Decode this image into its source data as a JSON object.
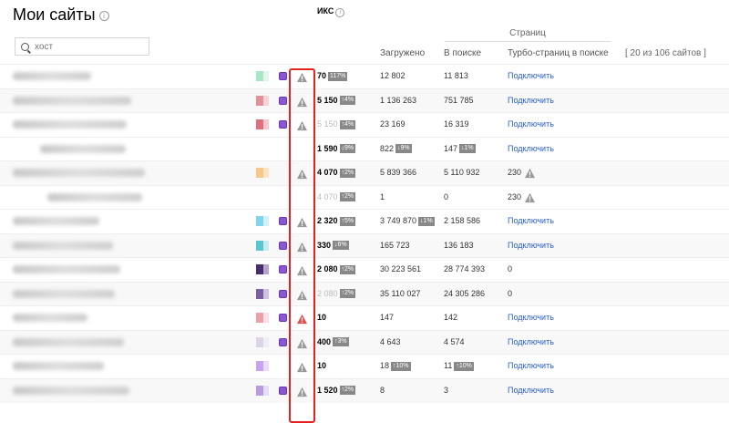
{
  "page": {
    "title": "Мои сайты",
    "info_glyph": "i"
  },
  "search": {
    "placeholder": "хост"
  },
  "header": {
    "group_label": "Страниц",
    "iks": "ИКС",
    "loaded": "Загружено",
    "in_search": "В поиске",
    "turbo": "Турбо-страниц в поиске",
    "count": "[ 20 из 106 сайтов ]"
  },
  "colors": {
    "link": "#2a60c7",
    "highlight": "#e52222",
    "warn_gray": "#999999",
    "warn_red": "#e05050",
    "favicon": "#8b57d1"
  },
  "rows": [
    {
      "host_w": 86,
      "indent": 0,
      "swatches": [
        "#a6e7c6",
        "#e6f4ea"
      ],
      "favicon": true,
      "warn": "gray",
      "iks": "70",
      "iks_badge": "117%",
      "iks_dim": false,
      "loaded": "12 802",
      "loaded_badge": "",
      "in_search": "11 813",
      "search_badge": "",
      "turbo_type": "link",
      "turbo": "Подключить",
      "alt": false
    },
    {
      "host_w": 130,
      "indent": 0,
      "swatches": [
        "#e3909b",
        "#f5d3d7"
      ],
      "favicon": true,
      "warn": "gray",
      "iks": "5 150",
      "iks_badge": "↑4%",
      "iks_dim": false,
      "loaded": "1 136 263",
      "loaded_badge": "",
      "in_search": "751 785",
      "search_badge": "",
      "turbo_type": "link",
      "turbo": "Подключить",
      "alt": true
    },
    {
      "host_w": 125,
      "indent": 0,
      "swatches": [
        "#e1707c",
        "#f4c9ce"
      ],
      "favicon": true,
      "warn": "gray",
      "iks": "5 150",
      "iks_badge": "↑4%",
      "iks_dim": true,
      "loaded": "23 169",
      "loaded_badge": "",
      "in_search": "16 319",
      "search_badge": "",
      "turbo_type": "link",
      "turbo": "Подключить",
      "alt": false
    },
    {
      "host_w": 94,
      "indent": 30,
      "swatches": [],
      "favicon": false,
      "warn": "none",
      "iks": "1 590",
      "iks_badge": "↓9%",
      "iks_dim": false,
      "loaded": "822",
      "loaded_badge": "↓9%",
      "in_search": "147",
      "search_badge": "↓1%",
      "turbo_type": "link",
      "turbo": "Подключить",
      "alt": false
    },
    {
      "host_w": 145,
      "indent": 0,
      "swatches": [
        "#f6c88c",
        "#fbe3c4"
      ],
      "favicon": false,
      "warn": "gray",
      "iks": "4 070",
      "iks_badge": "↑2%",
      "iks_dim": false,
      "loaded": "5 839 366",
      "loaded_badge": "",
      "in_search": "5 110 932",
      "search_badge": "",
      "turbo_type": "num",
      "turbo": "230",
      "alt": true
    },
    {
      "host_w": 104,
      "indent": 38,
      "swatches": [],
      "favicon": false,
      "warn": "none",
      "iks": "4 070",
      "iks_badge": "↑2%",
      "iks_dim": true,
      "loaded": "1",
      "loaded_badge": "",
      "in_search": "0",
      "search_badge": "",
      "turbo_type": "num",
      "turbo": "230",
      "alt": false
    },
    {
      "host_w": 95,
      "indent": 0,
      "swatches": [
        "#7fd6ee",
        "#d4f1f9"
      ],
      "favicon": true,
      "warn": "gray",
      "iks": "2 320",
      "iks_badge": "↑5%",
      "iks_dim": false,
      "loaded": "3 749 870",
      "loaded_badge": "↓1%",
      "in_search": "2 158 586",
      "search_badge": "",
      "turbo_type": "link",
      "turbo": "Подключить",
      "alt": false
    },
    {
      "host_w": 110,
      "indent": 0,
      "swatches": [
        "#59c7cf",
        "#c5ebee"
      ],
      "favicon": true,
      "warn": "gray",
      "iks": "330",
      "iks_badge": "↓6%",
      "iks_dim": false,
      "loaded": "165 723",
      "loaded_badge": "",
      "in_search": "136 183",
      "search_badge": "",
      "turbo_type": "link",
      "turbo": "Подключить",
      "alt": true
    },
    {
      "host_w": 118,
      "indent": 0,
      "swatches": [
        "#4a2d6f",
        "#b5a5ca"
      ],
      "favicon": true,
      "warn": "gray",
      "iks": "2 080",
      "iks_badge": "↑2%",
      "iks_dim": false,
      "loaded": "30 223 561",
      "loaded_badge": "",
      "in_search": "28 774 393",
      "search_badge": "",
      "turbo_type": "num",
      "turbo": "0",
      "alt": false
    },
    {
      "host_w": 112,
      "indent": 0,
      "swatches": [
        "#7a5fa3",
        "#cfc3df"
      ],
      "favicon": true,
      "warn": "gray",
      "iks": "2 080",
      "iks_badge": "↑2%",
      "iks_dim": true,
      "loaded": "35 110 027",
      "loaded_badge": "",
      "in_search": "24 305 286",
      "search_badge": "",
      "turbo_type": "num",
      "turbo": "0",
      "alt": true
    },
    {
      "host_w": 82,
      "indent": 0,
      "swatches": [
        "#ef9fa8",
        "#fbe1e4"
      ],
      "favicon": true,
      "warn": "red",
      "iks": "10",
      "iks_badge": "",
      "iks_dim": false,
      "loaded": "147",
      "loaded_badge": "",
      "in_search": "142",
      "search_badge": "",
      "turbo_type": "link",
      "turbo": "Подключить",
      "alt": false
    },
    {
      "host_w": 122,
      "indent": 0,
      "swatches": [
        "#dcd5e8",
        "#f2eef7"
      ],
      "favicon": true,
      "warn": "gray",
      "iks": "400",
      "iks_badge": "↑3%",
      "iks_dim": false,
      "loaded": "4 643",
      "loaded_badge": "",
      "in_search": "4 574",
      "search_badge": "",
      "turbo_type": "link",
      "turbo": "Подключить",
      "alt": true
    },
    {
      "host_w": 100,
      "indent": 0,
      "swatches": [
        "#c7a3f0",
        "#eadcfb"
      ],
      "favicon": false,
      "warn": "gray",
      "iks": "10",
      "iks_badge": "",
      "iks_dim": false,
      "loaded": "18",
      "loaded_badge": "↑10%",
      "in_search": "11",
      "search_badge": "↑10%",
      "turbo_type": "link",
      "turbo": "Подключить",
      "alt": false
    },
    {
      "host_w": 128,
      "indent": 0,
      "swatches": [
        "#b89be0",
        "#e6dcf5"
      ],
      "favicon": true,
      "warn": "gray",
      "iks": "1 520",
      "iks_badge": "↑2%",
      "iks_dim": false,
      "loaded": "8",
      "loaded_badge": "",
      "in_search": "3",
      "search_badge": "",
      "turbo_type": "link",
      "turbo": "Подключить",
      "alt": true
    }
  ]
}
